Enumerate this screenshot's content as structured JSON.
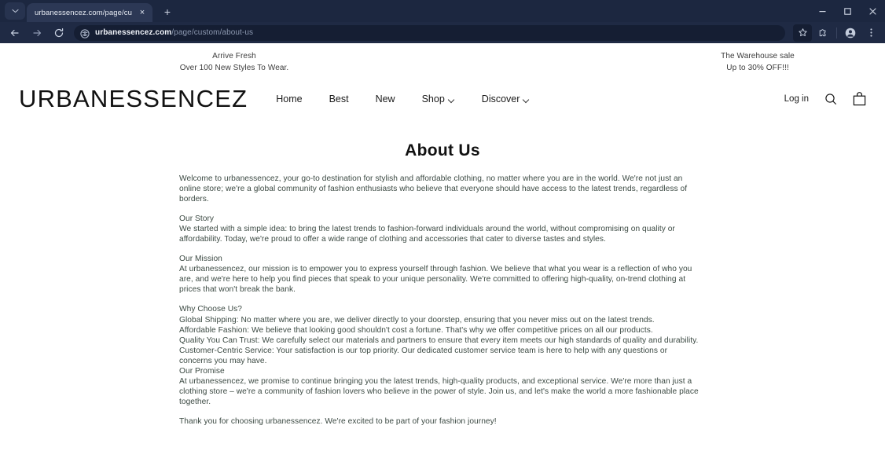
{
  "browser": {
    "tab": {
      "title": "urbanessencez.com/page/custo",
      "close_label": "×"
    },
    "newtab_label": "+",
    "tabstrip_chevron": "⌄",
    "window_controls": {
      "minimize": "minimize-icon",
      "maximize": "maximize-icon",
      "close": "close-icon"
    },
    "toolbar": {
      "back": "back-arrow-icon",
      "forward": "forward-arrow-icon",
      "reload": "reload-icon",
      "site_info": "site-settings-icon",
      "url_host": "urbanessencez.com",
      "url_path": "/page/custom/about-us",
      "bookmark": "star-icon",
      "extensions": "extensions-puzzle-icon",
      "profile": "profile-avatar-icon",
      "menu": "three-dot-menu-icon"
    }
  },
  "site": {
    "announcement_left": {
      "line1": "Arrive Fresh",
      "line2": "Over 100 New Styles To Wear."
    },
    "announcement_right": {
      "line1": "The Warehouse sale",
      "line2": "Up to 30% OFF!!!"
    },
    "logo": "URBANESSENCEZ",
    "nav": [
      {
        "label": "Home",
        "has_caret": false
      },
      {
        "label": "Best",
        "has_caret": false
      },
      {
        "label": "New",
        "has_caret": false
      },
      {
        "label": "Shop",
        "has_caret": true
      },
      {
        "label": "Discover",
        "has_caret": true
      }
    ],
    "actions": {
      "login_label": "Log in",
      "search_icon": "search-icon",
      "cart_icon": "shopping-bag-icon"
    }
  },
  "main": {
    "title": "About Us",
    "paragraphs": [
      {
        "lines": [
          "Welcome to urbanessencez, your go-to destination for stylish and affordable clothing, no matter where you are in the world. We're not just an",
          "online store; we're a global community of fashion enthusiasts who believe that everyone should have access to the latest trends, regardless of",
          "borders."
        ]
      },
      {
        "lines": [
          "Our Story",
          "We started with a simple idea: to bring the latest trends to fashion-forward individuals around the world, without compromising on quality or",
          "affordability. Today, we're proud to offer a wide range of clothing and accessories that cater to diverse tastes and styles."
        ]
      },
      {
        "lines": [
          "Our Mission",
          "At urbanessencez, our mission is to empower you to express yourself through fashion. We believe that what you wear is a reflection of who you",
          "are, and we're here to help you find pieces that speak to your unique personality. We're committed to offering high-quality, on-trend clothing at",
          "prices that won't break the bank."
        ]
      },
      {
        "lines": [
          "Why Choose Us?",
          "Global Shipping: No matter where you are, we deliver directly to your doorstep, ensuring that you never miss out on the latest trends.",
          "Affordable Fashion: We believe that looking good shouldn't cost a fortune. That's why we offer competitive prices on all our products.",
          "Quality You Can Trust: We carefully select our materials and partners to ensure that every item meets our high standards of quality and durability.",
          "Customer-Centric Service: Your satisfaction is our top priority. Our dedicated customer service team is here to help with any questions or",
          "concerns you may have.",
          "Our Promise",
          "At urbanessencez, we promise to continue bringing you the latest trends, high-quality products, and exceptional service. We're more than just a",
          "clothing store – we're a community of fashion lovers who believe in the power of style. Join us, and let's make the world a more fashionable place",
          "together."
        ]
      },
      {
        "lines": [
          "Thank you for choosing urbanessencez. We're excited to be part of your fashion journey!"
        ]
      }
    ]
  },
  "colors": {
    "chrome_bg": "#1f2a44",
    "tabstrip_bg": "#1c2740",
    "active_tab_bg": "#2c3855",
    "omnibox_bg": "#151e33",
    "page_bg": "#ffffff",
    "body_text": "#3c4a43",
    "heading": "#111111"
  }
}
